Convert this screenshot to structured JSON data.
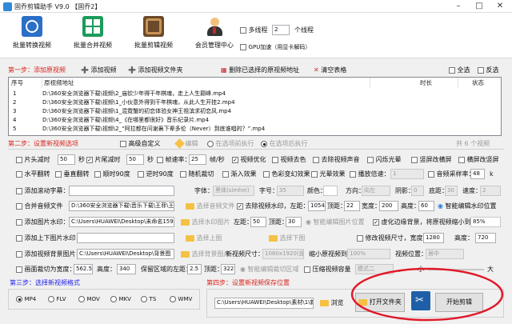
{
  "app": {
    "title": "固乔剪辑助手 V9.0 【固乔2】"
  },
  "toolbar": {
    "items": [
      {
        "label": "批量转换视频",
        "icon": "convert-video-icon"
      },
      {
        "label": "批量合并视频",
        "icon": "merge-video-icon"
      },
      {
        "label": "批量剪辑视频",
        "icon": "edit-video-icon"
      },
      {
        "label": "会员管理中心",
        "icon": "member-center-icon"
      }
    ],
    "multithread_label": "多线程",
    "threads": "2",
    "threads_unit": "个线程",
    "gpu_label": "GPU加速（用显卡解码）"
  },
  "step1": {
    "title": "第一步：添加原视频",
    "add_video": "添加视频",
    "add_folder": "添加视频文件夹",
    "remove_selected": "删除已选择的原视频地址",
    "clear_table": "清空表格",
    "select_all": "全选",
    "invert": "反选"
  },
  "table": {
    "columns": [
      "序号",
      "原视频地址",
      "时长",
      "状态"
    ],
    "rows": [
      {
        "no": "1",
        "path": "D:\\360安全浏览器下载\\视频\\2_庙钦少年得干年棋魂，走上人生巅峰.mp4"
      },
      {
        "no": "2",
        "path": "D:\\360安全浏览器下载\\视频\\1_小伙意外得到干年棋魂，从此人生开挂2.mp4"
      },
      {
        "no": "3",
        "path": "D:\\360安全浏览器下载\\视频\\1_混霓蟹的初恋体验女神王祖滨求初恋风.mp4"
      },
      {
        "no": "4",
        "path": "D:\\360安全浏览器下载\\视频\\4_《在哪里都很好》音乐纪录片.mp4"
      },
      {
        "no": "5",
        "path": "D:\\360安全浏览器下载\\视频\\2_“阿拉都在问谢襄下辈多伦（Never）到底谁唱的？”.mp4"
      }
    ]
  },
  "step2": {
    "title": "第二步：设置新视频选项",
    "advanced": "高级自定义",
    "edit": "编辑",
    "mode1": "在选项前执行",
    "mode2": "在选项后执行",
    "count": "共 6 个视频"
  },
  "opts": {
    "head_cut": "片头减时",
    "head_val": "50",
    "sec": "秒",
    "tail_cut": "片尾减时",
    "tail_val": "50",
    "sec2": "秒",
    "fps_label": "帧速率：",
    "fps_val": "25",
    "fps_unit": "帧/秒",
    "optimize": "视频优化",
    "decolor": "视频去色",
    "remove_audio": "去除视频声音",
    "flash": "闪烁光晕",
    "vert_blur": "竖屏改横屏",
    "horiz_blur": "横屏改竖屏",
    "hflip": "水平翻转",
    "vflip": "垂直翻转",
    "cw90": "顺时90度",
    "ccw90": "逆时90度",
    "random_crop": "随机裁切",
    "fade": "渐入效果",
    "color_change": "色彩变幻效果",
    "light_effect": "光晕效果",
    "speed_label": "播放倍速：",
    "speed_val": "1",
    "sample_rate": "音频采样率：",
    "sample_val": "48",
    "k": "k",
    "scroll_sub": "添加滚动字幕：",
    "font": "字体：",
    "font_val": "黑体(simhei)",
    "size": "字号：",
    "size_val": "35",
    "color": "颜色：",
    "direction": "方向：",
    "direction_val": "向左",
    "shadow": "阴影：",
    "shadow_val": "0",
    "bottom": "底距：",
    "bottom_val": "30",
    "speed": "速度：",
    "speed2_val": "2",
    "merge_audio": "合并音频文件",
    "audio_path": "D:\\360安全浏览器下载\\音乐下载\\王菲\\王菲",
    "select_audio": "选择音频文件",
    "remove_wm": "去除视频水印，左距：",
    "wm_left": "1054",
    "wm_top_label": "顶距：",
    "wm_top": "22",
    "wm_width_label": "宽度：",
    "wm_width": "200",
    "wm_height_label": "高度：",
    "wm_height": "60",
    "smart_wm": "智能编辑水印位置",
    "img_wm": "添加图片水印：",
    "img_path": "C:\\Users\\HUAWEI\\Desktop\\未命名159470",
    "select_wm_img": "选择水印图片",
    "img_left_label": "左距：",
    "img_left": "50",
    "img_top_label": "顶距：",
    "img_top": "30",
    "smart_img": "智能编辑图片位置",
    "blur_bg": "虚化边缘背景，将原视频缩小到：",
    "blur_val": "85%",
    "head_tail_img": "添加上下图片水印：",
    "top_img": "选择上图",
    "bottom_img": "选择下图",
    "resize": "修改视频尺寸，宽度：",
    "resize_w": "1280",
    "resize_h_label": "高度：",
    "resize_h": "720",
    "video_bg": "添加视频背景图片：",
    "bg_path": "C:\\Users\\HUAWEI\\Desktop\\背景图",
    "select_bg": "选择背景图片",
    "new_size": "新视频尺寸：",
    "new_size_val": "1080x1920(竖屏)",
    "shrink": "缩小原视频到：",
    "shrink_val": "100%",
    "pos": "视频位置：",
    "pos_val": "居中",
    "crop_to": "画面裁切为宽度：",
    "crop_w": "562.5",
    "crop_h_label": "高度：",
    "crop_h": "340",
    "keep_left": "保留区域的左距：",
    "keep_left_val": "2.5",
    "keep_top": "顶距：",
    "keep_top_val": "322",
    "smart_crop": "智能编辑裁切区域",
    "compress": "压缩视频容量",
    "mode_label": "模式二",
    "dot": "。",
    "small": "小",
    "big": "大"
  },
  "step3": {
    "title": "第三步：选择新视频格式",
    "formats": [
      "MP4",
      "FLV",
      "MOV",
      "MKV",
      "TS",
      "WMV"
    ],
    "selected": "MP4"
  },
  "step4": {
    "title": "第四步：设置新视频保存位置",
    "save_path": "C:\\Users\\HUAWEI\\Desktop\\素材\\1\\新",
    "browse": "浏览",
    "open_folder": "打开文件夹",
    "start": "开始剪辑"
  },
  "colors": {
    "accent_red": "#d9241c",
    "step_blue": "#2121ee",
    "annotation": "#e0192a"
  }
}
